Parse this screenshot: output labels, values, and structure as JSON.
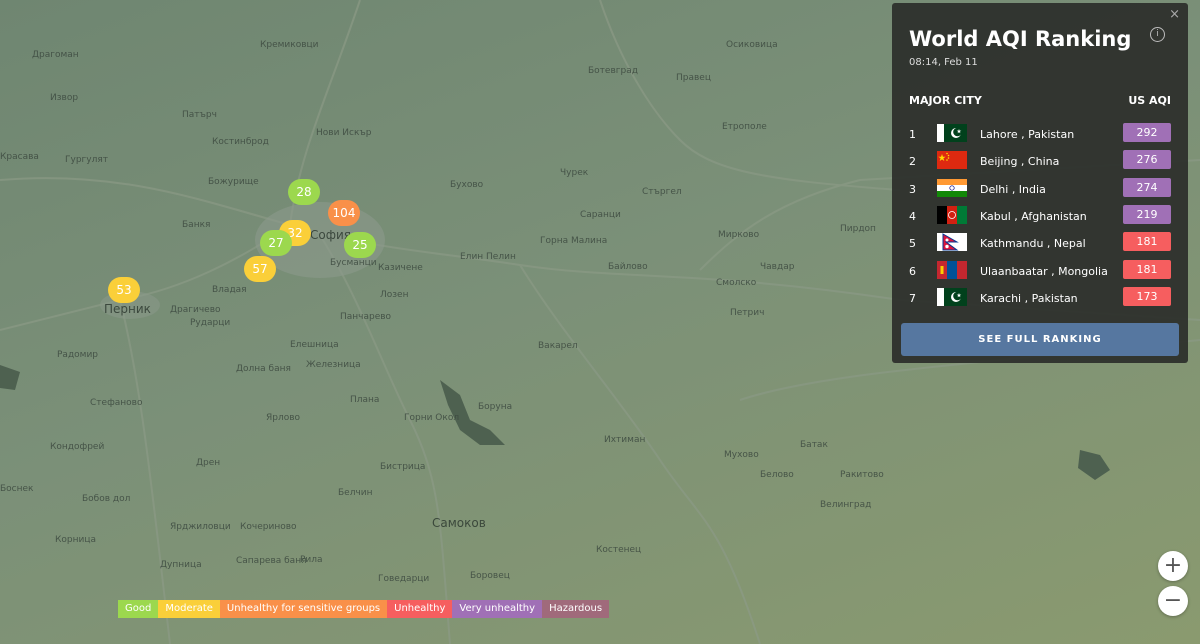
{
  "map": {
    "places": [
      {
        "name": "Драгоман",
        "cls": ""
      },
      {
        "name": "Извор",
        "cls": ""
      },
      {
        "name": "Патърч",
        "cls": ""
      },
      {
        "name": "Костинброд",
        "cls": ""
      },
      {
        "name": "Красава",
        "cls": ""
      },
      {
        "name": "Гургулят",
        "cls": ""
      },
      {
        "name": "Божурище",
        "cls": ""
      },
      {
        "name": "Банкя",
        "cls": ""
      },
      {
        "name": "Владая",
        "cls": ""
      },
      {
        "name": "Перник",
        "cls": "big"
      },
      {
        "name": "Драгичево",
        "cls": ""
      },
      {
        "name": "Рударци",
        "cls": ""
      },
      {
        "name": "Радомир",
        "cls": ""
      },
      {
        "name": "Стефаново",
        "cls": ""
      },
      {
        "name": "Кондофрей",
        "cls": ""
      },
      {
        "name": "Дрен",
        "cls": ""
      },
      {
        "name": "Боснек",
        "cls": ""
      },
      {
        "name": "Ярлово",
        "cls": ""
      },
      {
        "name": "Плана",
        "cls": ""
      },
      {
        "name": "Горни Окол",
        "cls": ""
      },
      {
        "name": "Самоков",
        "cls": "big"
      },
      {
        "name": "Говедарци",
        "cls": ""
      },
      {
        "name": "Боровец",
        "cls": ""
      },
      {
        "name": "Костенец",
        "cls": ""
      },
      {
        "name": "Ихтиман",
        "cls": ""
      },
      {
        "name": "Вакарел",
        "cls": ""
      },
      {
        "name": "Панчарево",
        "cls": ""
      },
      {
        "name": "Елин Пелин",
        "cls": ""
      },
      {
        "name": "Горна Малина",
        "cls": ""
      },
      {
        "name": "Байлово",
        "cls": ""
      },
      {
        "name": "Ботевград",
        "cls": ""
      },
      {
        "name": "Правец",
        "cls": ""
      },
      {
        "name": "Осиковица",
        "cls": ""
      },
      {
        "name": "Етрополе",
        "cls": ""
      },
      {
        "name": "Стъргел",
        "cls": ""
      },
      {
        "name": "Мирково",
        "cls": ""
      },
      {
        "name": "Чавдар",
        "cls": ""
      },
      {
        "name": "Смолско",
        "cls": ""
      },
      {
        "name": "Петрич",
        "cls": ""
      },
      {
        "name": "Пирдоп",
        "cls": ""
      },
      {
        "name": "Мухово",
        "cls": ""
      },
      {
        "name": "Белово",
        "cls": ""
      },
      {
        "name": "Велинград",
        "cls": ""
      },
      {
        "name": "Ракитово",
        "cls": ""
      },
      {
        "name": "Батак",
        "cls": ""
      },
      {
        "name": "Долна баня",
        "cls": ""
      },
      {
        "name": "Бусманци",
        "cls": ""
      },
      {
        "name": "Нови Искър",
        "cls": ""
      },
      {
        "name": "Елешница",
        "cls": ""
      },
      {
        "name": "Чурек",
        "cls": ""
      },
      {
        "name": "Саранци",
        "cls": ""
      },
      {
        "name": "Бухово",
        "cls": ""
      },
      {
        "name": "Кремиковци",
        "cls": ""
      },
      {
        "name": "Казичене",
        "cls": ""
      },
      {
        "name": "Лозен",
        "cls": ""
      },
      {
        "name": "Железница",
        "cls": ""
      },
      {
        "name": "Бистрица",
        "cls": ""
      },
      {
        "name": "Белчин",
        "cls": ""
      },
      {
        "name": "Боруна",
        "cls": ""
      },
      {
        "name": "Сапарева баня",
        "cls": ""
      },
      {
        "name": "Дупница",
        "cls": ""
      },
      {
        "name": "Бобов дол",
        "cls": ""
      },
      {
        "name": "Ярджиловци",
        "cls": ""
      },
      {
        "name": "Корница",
        "cls": ""
      },
      {
        "name": "Кочериново",
        "cls": ""
      },
      {
        "name": "Рила",
        "cls": ""
      }
    ],
    "markers": [
      {
        "label": "28",
        "category": "good"
      },
      {
        "label": "104",
        "category": "sensitive"
      },
      {
        "label": "32",
        "category": "moderate"
      },
      {
        "label": "27",
        "category": "good"
      },
      {
        "label": "25",
        "category": "good"
      },
      {
        "label": "57",
        "category": "moderate"
      },
      {
        "label": "53",
        "category": "moderate"
      }
    ],
    "city_label": "София"
  },
  "legend": [
    {
      "label": "Good",
      "color": "#9cd84e"
    },
    {
      "label": "Moderate",
      "color": "#facf39"
    },
    {
      "label": "Unhealthy for sensitive groups",
      "color": "#f99049"
    },
    {
      "label": "Unhealthy",
      "color": "#f65e5f"
    },
    {
      "label": "Very unhealthy",
      "color": "#a070b6"
    },
    {
      "label": "Hazardous",
      "color": "#a06a7b"
    }
  ],
  "category_colors": {
    "good": "#9cd84e",
    "moderate": "#facf39",
    "sensitive": "#f99049",
    "unhealthy": "#f65e5f",
    "very_unhealthy": "#a070b6",
    "hazardous": "#a06a7b"
  },
  "zoom": {
    "in_label": "+",
    "out_label": "−"
  },
  "panel": {
    "close_label": "×",
    "title": "World AQI Ranking",
    "info_label": "i",
    "timestamp": "08:14, Feb 11",
    "header_city": "MAJOR CITY",
    "header_aqi": "US AQI",
    "button_label": "SEE FULL RANKING",
    "rows": [
      {
        "rank": "1",
        "city": "Lahore , Pakistan",
        "aqi": "292",
        "category": "very_unhealthy",
        "flag": "pk"
      },
      {
        "rank": "2",
        "city": "Beijing , China",
        "aqi": "276",
        "category": "very_unhealthy",
        "flag": "cn"
      },
      {
        "rank": "3",
        "city": "Delhi , India",
        "aqi": "274",
        "category": "very_unhealthy",
        "flag": "in"
      },
      {
        "rank": "4",
        "city": "Kabul , Afghanistan",
        "aqi": "219",
        "category": "very_unhealthy",
        "flag": "af"
      },
      {
        "rank": "5",
        "city": "Kathmandu , Nepal",
        "aqi": "181",
        "category": "unhealthy",
        "flag": "np"
      },
      {
        "rank": "6",
        "city": "Ulaanbaatar , Mongolia",
        "aqi": "181",
        "category": "unhealthy",
        "flag": "mn"
      },
      {
        "rank": "7",
        "city": "Karachi , Pakistan",
        "aqi": "173",
        "category": "unhealthy",
        "flag": "pk"
      }
    ]
  }
}
